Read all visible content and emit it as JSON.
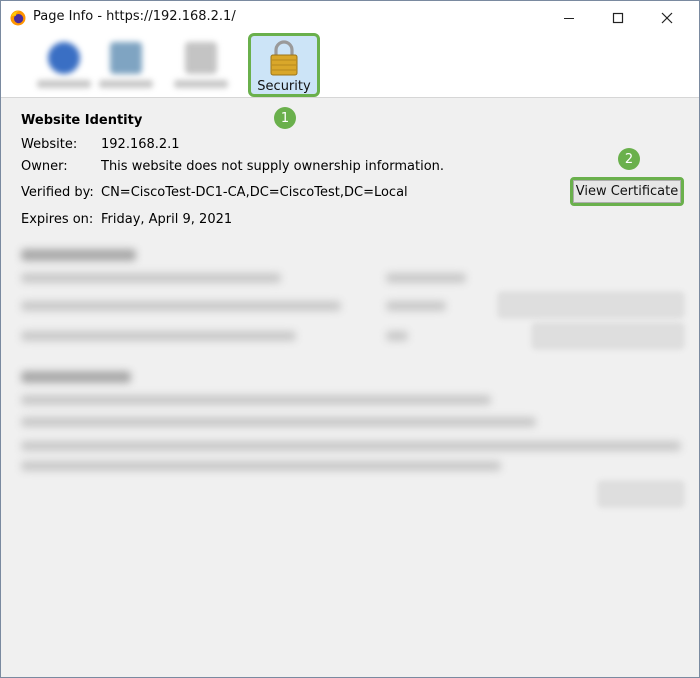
{
  "window": {
    "title": "Page Info - https://192.168.2.1/"
  },
  "toolbar": {
    "security_label": "Security"
  },
  "callouts": {
    "one": "1",
    "two": "2"
  },
  "identity": {
    "title": "Website Identity",
    "website_label": "Website:",
    "website_value": "192.168.2.1",
    "owner_label": "Owner:",
    "owner_value": "This website does not supply ownership information.",
    "verified_label": "Verified by:",
    "verified_value": "CN=CiscoTest-DC1-CA,DC=CiscoTest,DC=Local",
    "expires_label": "Expires on:",
    "expires_value": "Friday, April 9, 2021",
    "view_certificate_label": "View Certificate"
  },
  "colors": {
    "highlight": "#6ab04c",
    "selected_tab": "#cce4f7"
  }
}
